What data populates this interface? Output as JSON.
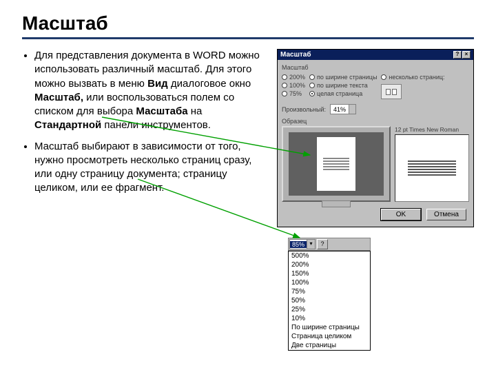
{
  "slide": {
    "title": "Масштаб",
    "bullets": [
      {
        "html": "Для представления документа в WORD можно использовать различный масштаб. Для этого можно вызвать в меню <b>Вид</b> диалоговое окно <b>Масштаб,</b> или воспользоваться полем со списком для выбора <b>Масштаба</b> на <b>Стандартной</b> панели инструментов."
      },
      {
        "html": "Масштаб выбирают в зависимости от того, нужно просмотреть несколько страниц сразу, или одну страницу документа; страницу целиком, или ее фрагмент."
      }
    ]
  },
  "dialog": {
    "title": "Масштаб",
    "group_label": "Масштаб",
    "left_opts": [
      "200%",
      "100%",
      "75%"
    ],
    "mid_opts": [
      "по ширине страницы",
      "по ширине текста",
      "целая страница"
    ],
    "right_opt": "несколько страниц:",
    "selected_mid": 2,
    "arbitrary_label": "Произвольный:",
    "arbitrary_value": "41%",
    "sample_label": "Образец",
    "sample_font": "12 pt Times New Roman",
    "ok": "OK",
    "cancel": "Отмена"
  },
  "dropdown": {
    "selected": "85%",
    "items": [
      "500%",
      "200%",
      "150%",
      "100%",
      "75%",
      "50%",
      "25%",
      "10%",
      "По ширине страницы",
      "Страница целиком",
      "Две страницы"
    ]
  }
}
